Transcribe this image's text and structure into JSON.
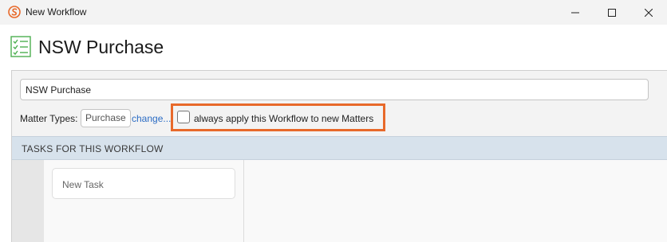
{
  "window": {
    "title": "New Workflow",
    "app_icon": "app-logo-icon",
    "controls": [
      "minimize-icon",
      "maximize-icon",
      "close-icon"
    ]
  },
  "header": {
    "title": "NSW Purchase",
    "icon": "checklist-icon"
  },
  "form": {
    "name_value": "NSW Purchase",
    "matter_types_label": "Matter Types:",
    "matter_type": "Purchase",
    "change_link": "change...",
    "always_apply_label": "always apply this Workflow to new Matters",
    "always_apply_checked": false
  },
  "tasks": {
    "header": "TASKS FOR THIS WORKFLOW",
    "items": [
      {
        "label": "New Task"
      }
    ]
  },
  "colors": {
    "highlight": "#e8692a",
    "link": "#2b6cc4",
    "tasks_header_bg": "#d7e2ec",
    "icon_green": "#4caf50",
    "app_icon_orange": "#e8692a"
  }
}
